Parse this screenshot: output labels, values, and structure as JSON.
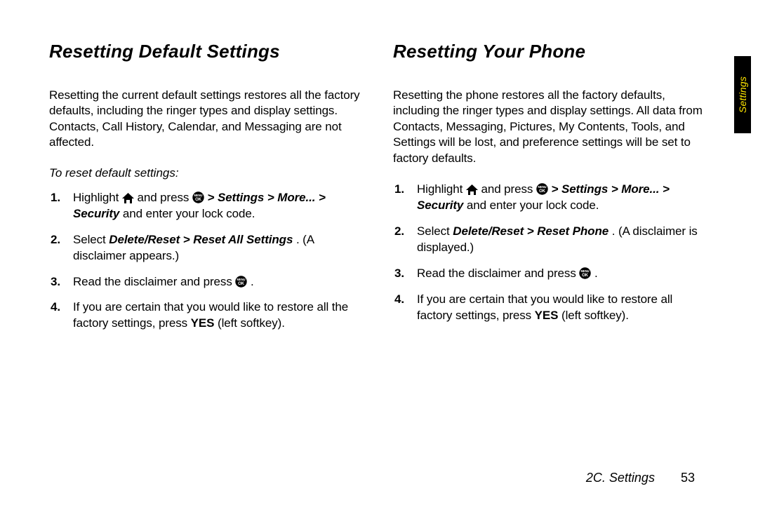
{
  "tab": {
    "label": "Settings"
  },
  "left": {
    "heading": "Resetting Default Settings",
    "intro": "Resetting the current default settings restores all the factory defaults, including the ringer types and display settings. Contacts, Call History, Calendar, and Messaging are not affected.",
    "subhead": "To reset default settings:",
    "steps": {
      "s1_a": "Highlight ",
      "s1_b": " and press ",
      "s1_path": " > Settings > More... > Security",
      "s1_c": " and enter your lock code.",
      "s2_a": "Select ",
      "s2_path": "Delete/Reset > Reset All Settings",
      "s2_b": ". (A disclaimer appears.)",
      "s3_a": "Read the disclaimer and press ",
      "s3_b": " .",
      "s4_a": "If you are certain that you would like to restore all the factory settings, press ",
      "s4_yes": "YES",
      "s4_b": " (left softkey)."
    }
  },
  "right": {
    "heading": "Resetting Your Phone",
    "intro": "Resetting the phone restores all the factory defaults, including the ringer types and display settings. All data from Contacts, Messaging, Pictures, My Contents, Tools, and Settings will be lost, and preference settings will be set to factory defaults.",
    "steps": {
      "s1_a": "Highlight ",
      "s1_b": " and press ",
      "s1_path": " > Settings > More... > Security",
      "s1_c": " and enter your lock code.",
      "s2_a": "Select ",
      "s2_path": "Delete/Reset > Reset Phone",
      "s2_b": ". (A disclaimer is displayed.)",
      "s3_a": "Read the disclaimer and press ",
      "s3_b": " .",
      "s4_a": "If you are certain that you would like to restore all factory settings, press ",
      "s4_yes": "YES",
      "s4_b": " (left softkey)."
    }
  },
  "footer": {
    "section": "2C. Settings",
    "page": "53"
  }
}
